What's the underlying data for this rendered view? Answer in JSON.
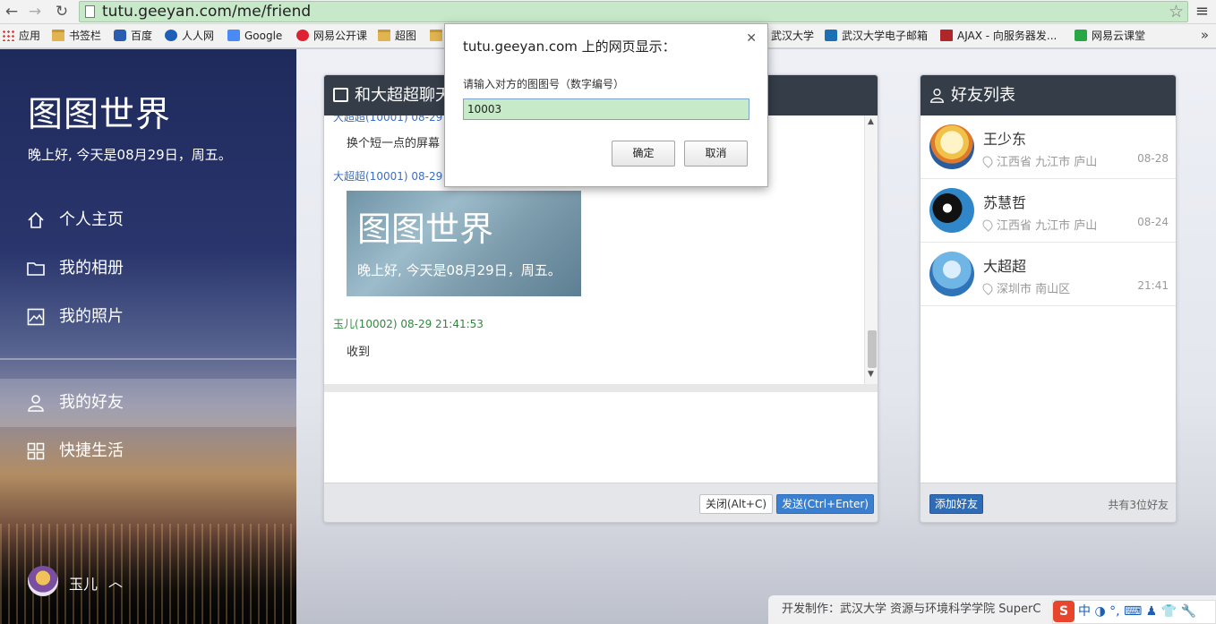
{
  "browser": {
    "url": "tutu.geeyan.com/me/friend",
    "bookmarks": [
      {
        "label": "应用",
        "icon": "apps-icon"
      },
      {
        "label": "书签栏",
        "icon": "folder-icon"
      },
      {
        "label": "百度",
        "icon": "baidu-icon"
      },
      {
        "label": "人人网",
        "icon": "renren-icon"
      },
      {
        "label": "Google",
        "icon": "google-icon"
      },
      {
        "label": "网易公开课",
        "icon": "netease-icon"
      },
      {
        "label": "超图",
        "icon": "folder-icon"
      },
      {
        "label": "武汉大学",
        "icon": "folder-icon"
      },
      {
        "label": "武汉大学电子邮箱",
        "icon": "c-icon"
      },
      {
        "label": "AJAX - 向服务器发...",
        "icon": "w3-icon"
      },
      {
        "label": "网易云课堂",
        "icon": "cloud-icon"
      }
    ]
  },
  "sidebar": {
    "site_title": "图图世界",
    "greeting": "晚上好, 今天是08月29日，周五。",
    "nav": [
      {
        "label": "个人主页",
        "icon": "home-icon"
      },
      {
        "label": "我的相册",
        "icon": "folder-icon"
      },
      {
        "label": "我的照片",
        "icon": "image-icon"
      },
      {
        "label": "我的好友",
        "icon": "user-icon",
        "active": true
      },
      {
        "label": "快捷生活",
        "icon": "grid-icon"
      }
    ],
    "user": {
      "name": "玉儿"
    }
  },
  "chat": {
    "title": "和大超超聊天",
    "messages": [
      {
        "meta": "大超超(10001) 08-29 2",
        "text": "换个短一点的屏幕"
      },
      {
        "meta": "大超超(10001) 08-29 2",
        "image": {
          "title": "图图世界",
          "subtitle": "晚上好, 今天是08月29日，周五。"
        }
      },
      {
        "meta": "玉儿(10002) 08-29 21:41:53",
        "text": "收到"
      }
    ],
    "close_label": "关闭(Alt+C)",
    "send_label": "发送(Ctrl+Enter)"
  },
  "friends": {
    "title": "好友列表",
    "items": [
      {
        "name": "王少东",
        "location": "江西省 九江市 庐山",
        "date": "08-28"
      },
      {
        "name": "苏慧哲",
        "location": "江西省 九江市 庐山",
        "date": "08-24"
      },
      {
        "name": "大超超",
        "location": "深圳市 南山区",
        "date": "21:41"
      }
    ],
    "add_label": "添加好友",
    "count_label": "共有3位好友"
  },
  "footer": {
    "credit": "开发制作：武汉大学 资源与环境科学学院 SuperC"
  },
  "ime": {
    "logo": "S",
    "text": "中 ◑ °, ⌨ ♟ 👕 🔧"
  },
  "dialog": {
    "title": "tutu.geeyan.com 上的网页显示：",
    "message": "请输入对方的图图号（数字编号）",
    "input_value": "10003",
    "ok_label": "确定",
    "cancel_label": "取消"
  }
}
